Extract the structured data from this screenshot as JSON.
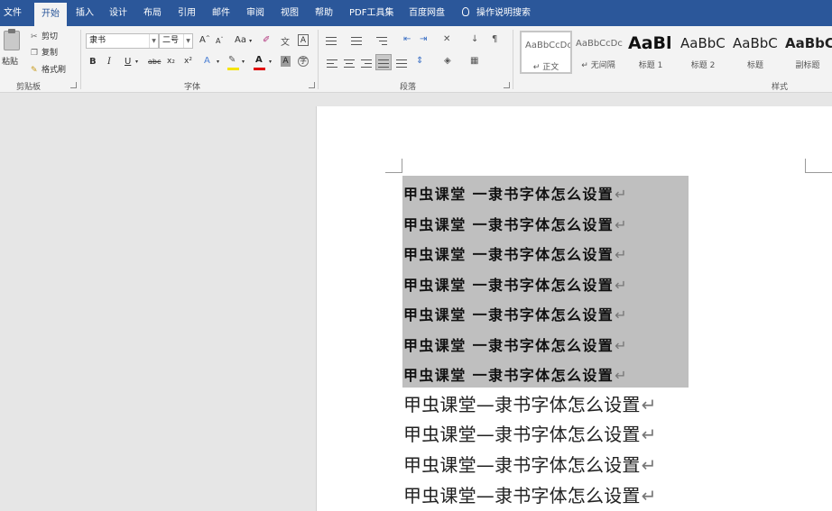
{
  "tabs": [
    {
      "label": "文件"
    },
    {
      "label": "开始"
    },
    {
      "label": "插入"
    },
    {
      "label": "设计"
    },
    {
      "label": "布局"
    },
    {
      "label": "引用"
    },
    {
      "label": "邮件"
    },
    {
      "label": "审阅"
    },
    {
      "label": "视图"
    },
    {
      "label": "帮助"
    },
    {
      "label": "PDF工具集"
    },
    {
      "label": "百度网盘"
    }
  ],
  "tell_me": "操作说明搜索",
  "clipboard": {
    "paste": "粘贴",
    "cut": "剪切",
    "copy": "复制",
    "format_painter": "格式刷",
    "group": "剪贴板"
  },
  "font": {
    "name": "隶书",
    "size": "二号",
    "group": "字体",
    "grow": "A",
    "shrink": "A",
    "case": "Aa",
    "bold": "B",
    "italic": "I",
    "underline": "U",
    "strike": "abc",
    "subscript": "x₂",
    "superscript": "x²",
    "font_color": "A",
    "char_shading": "A"
  },
  "paragraph": {
    "group": "段落"
  },
  "styles": {
    "group": "样式",
    "items": [
      {
        "sample": "AaBbCcDc",
        "name": "↵ 正文"
      },
      {
        "sample": "AaBbCcDc",
        "name": "↵ 无间隔"
      },
      {
        "sample": "AaBl",
        "name": "标题 1"
      },
      {
        "sample": "AaBbC",
        "name": "标题 2"
      },
      {
        "sample": "AaBbC",
        "name": "标题"
      },
      {
        "sample": "AaBbC",
        "name": "副标题"
      }
    ]
  },
  "document": {
    "selected_lines": [
      "甲虫课堂 一隶书字体怎么设置",
      "甲虫课堂 一隶书字体怎么设置",
      "甲虫课堂 一隶书字体怎么设置",
      "甲虫课堂 一隶书字体怎么设置",
      "甲虫课堂 一隶书字体怎么设置",
      "甲虫课堂 一隶书字体怎么设置",
      "甲虫课堂 一隶书字体怎么设置"
    ],
    "plain_lines": [
      "甲虫课堂—隶书字体怎么设置",
      "甲虫课堂—隶书字体怎么设置",
      "甲虫课堂—隶书字体怎么设置",
      "甲虫课堂—隶书字体怎么设置"
    ],
    "paragraph_mark": "↵"
  },
  "colors": {
    "tab_bar": "#2b579a",
    "ribbon": "#f3f3f3",
    "selection": "#bfbfbf",
    "font_color_bar": "#e00000",
    "highlight_bar": "#f5e400"
  }
}
